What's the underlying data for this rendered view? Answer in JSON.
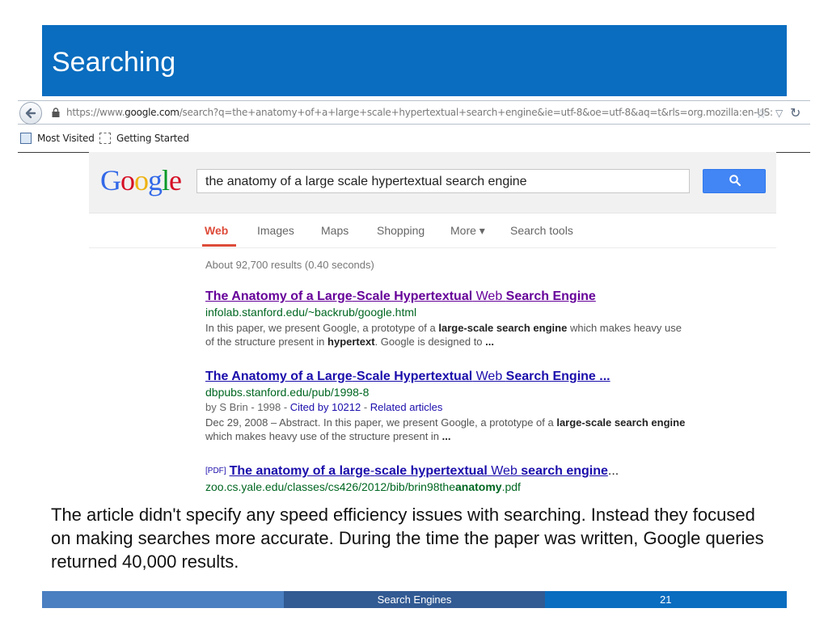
{
  "slide": {
    "title": "Searching",
    "body": "The article didn't specify any speed efficiency issues with searching. Instead they focused on making searches more accurate. During the time the paper was written, Google queries returned 40,000 results.",
    "footer_label": "Search Engines",
    "page_number": "21",
    "colors": {
      "title_bar": "#0a6dbf",
      "footer_left": "#4a7fc1",
      "footer_mid": "#325a93",
      "footer_right": "#0a6dbf"
    }
  },
  "browser": {
    "url_prefix": "https://www.",
    "url_domain": "google.com",
    "url_rest": "/search?q=the+anatomy+of+a+large+scale+hypertextual+search+engine&ie=utf-8&oe=utf-8&aq=t&rls=org.mozilla:en-US:",
    "icons": [
      "back-arrow-icon",
      "lock-icon",
      "star-icon",
      "dropmarker-icon",
      "reload-icon"
    ],
    "bookmarks": [
      "Most Visited",
      "Getting Started"
    ]
  },
  "google": {
    "logo_letters": [
      {
        "ch": "G",
        "color": "#3369e8"
      },
      {
        "ch": "o",
        "color": "#d50f25"
      },
      {
        "ch": "o",
        "color": "#eeb211"
      },
      {
        "ch": "g",
        "color": "#3369e8"
      },
      {
        "ch": "l",
        "color": "#009925"
      },
      {
        "ch": "e",
        "color": "#d50f25"
      }
    ],
    "query": "the anatomy of a large scale hypertextual search engine",
    "tabs": {
      "web": "Web",
      "images": "Images",
      "maps": "Maps",
      "shopping": "Shopping",
      "more": "More ▾",
      "search_tools": "Search tools"
    },
    "result_stats": "About 92,700 results (0.40 seconds)",
    "results": [
      {
        "title_parts": [
          {
            "text": "The Anatomy of a Large",
            "bold": true
          },
          {
            "text": "-",
            "bold": false
          },
          {
            "text": "Scale Hypertextual",
            "bold": true
          },
          {
            "text": " Web ",
            "bold": false
          },
          {
            "text": "Search Engine",
            "bold": true
          }
        ],
        "url": "infolab.stanford.edu/~backrub/google.html",
        "snippet_parts": [
          {
            "text": "In this paper, we present Google, a prototype of a ",
            "bold": false
          },
          {
            "text": "large-scale search engine",
            "bold": true
          },
          {
            "text": " which makes heavy use of the structure present in ",
            "bold": false
          },
          {
            "text": "hypertext",
            "bold": true
          },
          {
            "text": ". Google is designed to ",
            "bold": false
          },
          {
            "text": "...",
            "bold": true
          }
        ]
      },
      {
        "title_parts": [
          {
            "text": "The Anatomy of a Large",
            "bold": true
          },
          {
            "text": "-",
            "bold": false
          },
          {
            "text": "Scale Hypertextual",
            "bold": true
          },
          {
            "text": " Web ",
            "bold": false
          },
          {
            "text": "Search Engine ...",
            "bold": true
          }
        ],
        "url": "dbpubs.stanford.edu/pub/1998-8",
        "meta_prefix": "by S Brin - 1998 - ",
        "cited_by": "Cited by 10212",
        "meta_sep": " - ",
        "related": "Related articles",
        "snippet_parts": [
          {
            "text": "Dec 29, 2008 – Abstract. In this paper, we present Google, a prototype of a ",
            "bold": false
          },
          {
            "text": "large-scale search engine",
            "bold": true
          },
          {
            "text": " which makes heavy use of the structure present in ",
            "bold": false
          },
          {
            "text": "...",
            "bold": true
          }
        ]
      },
      {
        "pdf_tag": "[PDF]",
        "title_parts": [
          {
            "text": "The anatomy of a large",
            "bold": true
          },
          {
            "text": "-",
            "bold": false
          },
          {
            "text": "scale hypertextual",
            "bold": true
          },
          {
            "text": " Web ",
            "bold": false
          },
          {
            "text": "search engine",
            "bold": true
          }
        ],
        "title_ellipsis": "...",
        "url_parts": [
          {
            "text": "zoo.cs.yale.edu/classes/cs426/2012/bib/brin98the",
            "bold": false
          },
          {
            "text": "anatomy",
            "bold": true
          },
          {
            "text": ".pdf",
            "bold": false
          }
        ]
      }
    ]
  }
}
